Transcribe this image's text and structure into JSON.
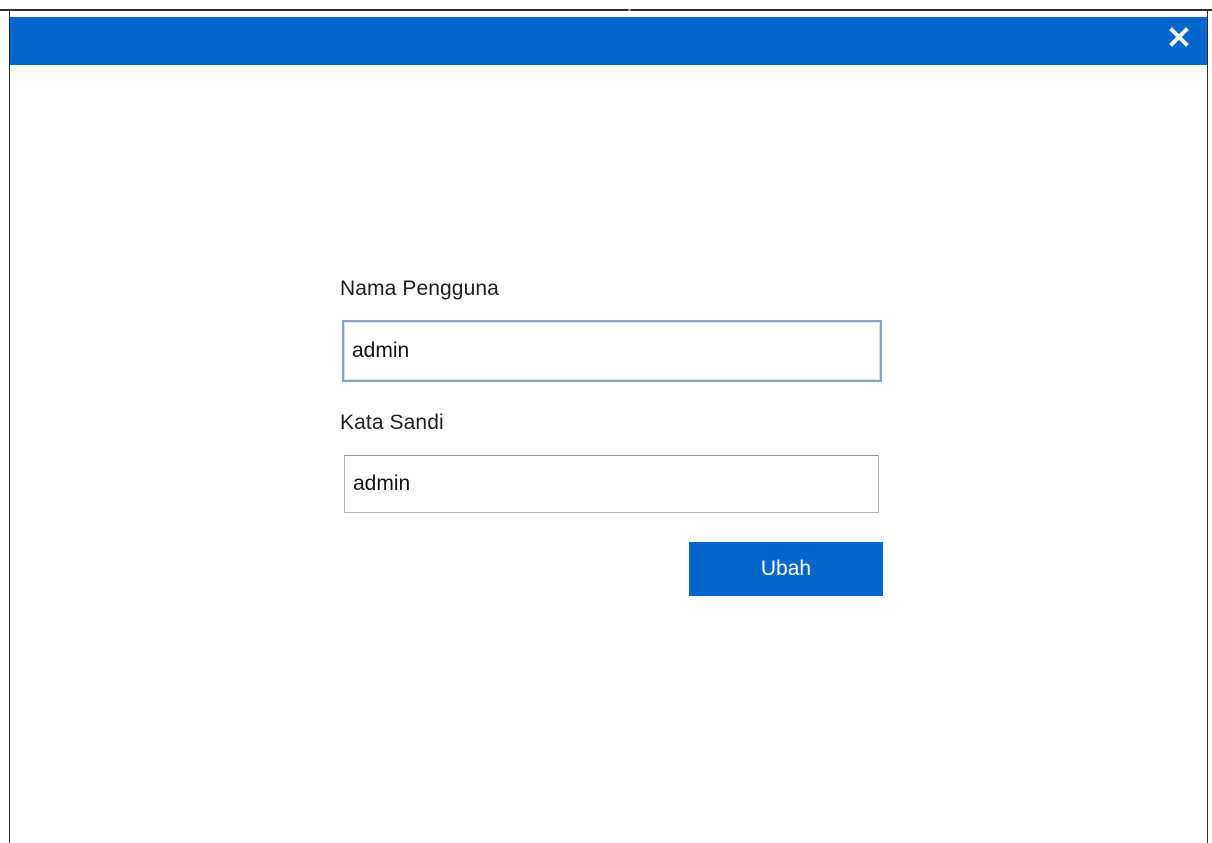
{
  "dialog": {
    "close_icon": "close-icon",
    "accent_color": "#0066cc"
  },
  "form": {
    "username_label": "Nama Pengguna",
    "username_value": "admin",
    "password_label": "Kata Sandi",
    "password_value": "admin",
    "submit_label": "Ubah"
  }
}
